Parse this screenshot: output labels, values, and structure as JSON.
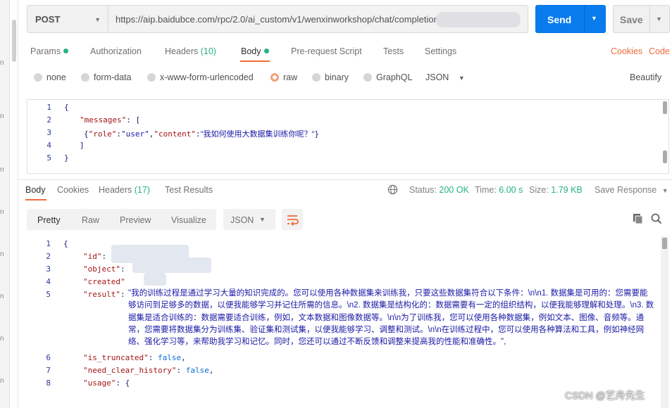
{
  "request": {
    "method": "POST",
    "url": "https://aip.baidubce.com/rpc/2.0/ai_custom/v1/wenxinworkshop/chat/completion",
    "send_label": "Send",
    "save_label": "Save"
  },
  "tabs": {
    "params": "Params",
    "authorization": "Authorization",
    "headers": "Headers",
    "headers_count": "(10)",
    "body": "Body",
    "prerequest": "Pre-request Script",
    "tests": "Tests",
    "settings": "Settings",
    "cookies": "Cookies",
    "code": "Code"
  },
  "body_types": {
    "none": "none",
    "form_data": "form-data",
    "urlencoded": "x-www-form-urlencoded",
    "raw": "raw",
    "binary": "binary",
    "graphql": "GraphQL",
    "format": "JSON",
    "beautify": "Beautify"
  },
  "request_body": {
    "line_numbers": [
      "1",
      "2",
      "3",
      "4",
      "5"
    ],
    "lines": {
      "l1": "{",
      "l2_key": "\"messages\"",
      "l2_rest": ": [",
      "l3_role_key": "\"role\"",
      "l3_role_val": "\"user\"",
      "l3_content_key": "\"content\"",
      "l3_content_val": "\"我如何使用大数据集训练你呢？\"",
      "l4": "]",
      "l5": "}"
    }
  },
  "response_tabs": {
    "body": "Body",
    "cookies": "Cookies",
    "headers": "Headers",
    "headers_count": "(17)",
    "test_results": "Test Results",
    "status_label": "Status:",
    "status_value": "200 OK",
    "time_label": "Time:",
    "time_value": "6.00 s",
    "size_label": "Size:",
    "size_value": "1.79 KB",
    "save_response": "Save Response"
  },
  "view": {
    "pretty": "Pretty",
    "raw": "Raw",
    "preview": "Preview",
    "visualize": "Visualize",
    "format": "JSON"
  },
  "response_body": {
    "line_numbers_top": [
      "1",
      "2",
      "3",
      "4",
      "5"
    ],
    "line_numbers_bottom": [
      "6",
      "7",
      "8"
    ],
    "l1": "{",
    "id_key": "\"id\"",
    "object_key": "\"object\"",
    "created_key": "\"created\"",
    "result_key": "\"result\"",
    "result_value": "\"我的训练过程是通过学习大量的知识完成的。您可以使用各种数据集来训练我，只要这些数据集符合以下条件：\\n\\n1. 数据集是可用的：您需要能够访问到足够多的数据，以便我能够学习并记住所需的信息。\\n2. 数据集是结构化的：数据需要有一定的组织结构，以便我能够理解和处理。\\n3. 数据集是适合训练的：数据需要适合训练，例如，文本数据和图像数据等。\\n\\n为了训练我，您可以使用各种数据集，例如文本、图像、音频等。通常，您需要将数据集分为训练集、验证集和测试集，以便我能够学习、调整和测试。\\n\\n在训练过程中，您可以使用各种算法和工具，例如神经网络、强化学习等，来帮助我学习和记忆。同时，您还可以通过不断反馈和调整来提高我的性能和准确性。\",",
    "is_truncated_key": "\"is_truncated\"",
    "is_truncated_val": "false",
    "need_clear_key": "\"need_clear_history\"",
    "need_clear_val": "false",
    "usage_key": "\"usage\"",
    "usage_rest": ": {"
  },
  "watermark": "CSDN @艺舟先生",
  "colors": {
    "accent": "#f26b3a",
    "send": "#097bed",
    "success": "#26b47f"
  }
}
